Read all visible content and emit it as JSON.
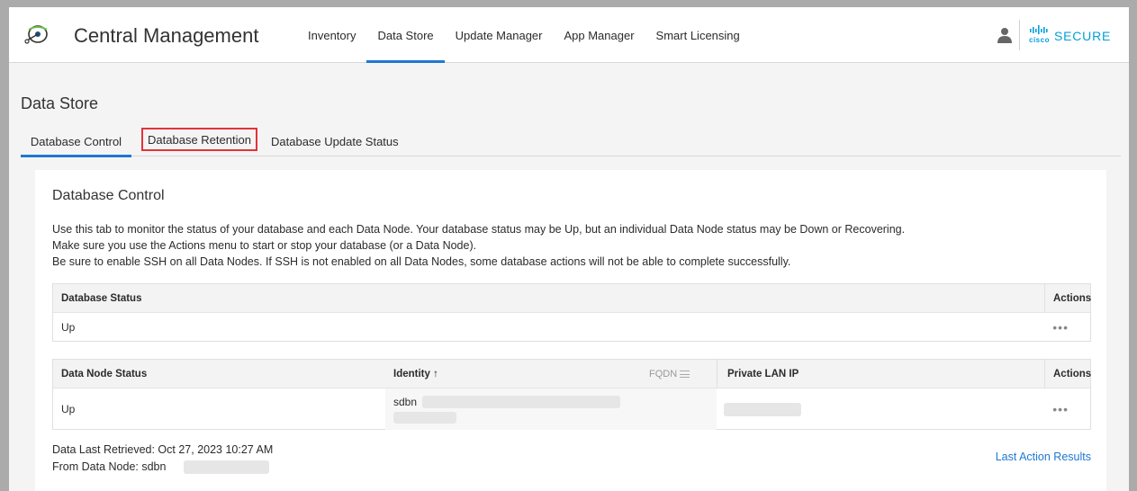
{
  "header": {
    "app_title": "Central Management",
    "nav": [
      "Inventory",
      "Data Store",
      "Update Manager",
      "App Manager",
      "Smart Licensing"
    ],
    "active_nav": "Data Store",
    "brand_small": "cisco",
    "brand": "SECURE",
    "brand_color": "#049fd9",
    "accent_color": "#1f78d1"
  },
  "page": {
    "title": "Data Store",
    "tabs": [
      "Database Control",
      "Database Retention",
      "Database Update Status"
    ],
    "active_tab": "Database Control",
    "highlighted_tab": "Database Retention"
  },
  "card": {
    "title": "Database Control",
    "description": [
      "Use this tab to monitor the status of your database and each Data Node. Your database status may be Up, but an individual Data Node status may be Down or Recovering.",
      "Make sure you use the Actions menu to start or stop your database (or a Data Node).",
      "Be sure to enable SSH on all Data Nodes. If SSH is not enabled on all Data Nodes, some database actions will not be able to complete successfully."
    ],
    "db_table": {
      "col_status": "Database Status",
      "col_actions": "Actions",
      "status": "Up",
      "actions_icon": "•••"
    },
    "node_table": {
      "col_status": "Data Node Status",
      "col_identity": "Identity ↑",
      "col_fqdn": "FQDN",
      "col_ip": "Private LAN IP",
      "col_actions": "Actions",
      "status": "Up",
      "identity_prefix": "sdbn",
      "actions_icon": "•••"
    },
    "last_retrieved": "Data Last Retrieved: Oct 27, 2023 10:27 AM",
    "from_node": "From Data Node: sdbn",
    "last_action_link": "Last Action Results"
  },
  "icons": {
    "logo": "central-management-logo-icon",
    "user": "user-icon",
    "fqdn_menu": "menu-lines-icon"
  }
}
